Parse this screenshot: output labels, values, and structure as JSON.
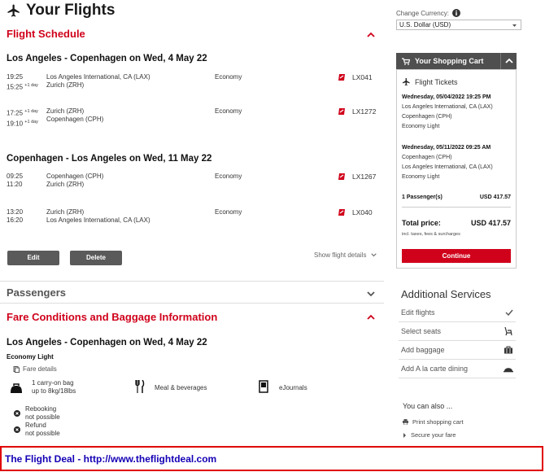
{
  "header": {
    "title": "Your Flights"
  },
  "schedule": {
    "title": "Flight Schedule",
    "outbound": {
      "title": "Los Angeles - Copenhagen on Wed, 4 May 22",
      "segments": [
        {
          "dep_time": "19:25",
          "arr_time": "15:25",
          "arr_day": "+1 day",
          "from": "Los Angeles International, CA (LAX)",
          "to": "Zurich (ZRH)",
          "class": "Economy",
          "flight": "LX041"
        },
        {
          "dep_time": "17:25",
          "dep_day": "+1 day",
          "arr_time": "19:10",
          "arr_day": "+1 day",
          "from": "Zurich (ZRH)",
          "to": "Copenhagen (CPH)",
          "class": "Economy",
          "flight": "LX1272"
        }
      ]
    },
    "inbound": {
      "title": "Copenhagen - Los Angeles on Wed, 11 May 22",
      "segments": [
        {
          "dep_time": "09:25",
          "arr_time": "11:20",
          "from": "Copenhagen (CPH)",
          "to": "Zurich (ZRH)",
          "class": "Economy",
          "flight": "LX1267"
        },
        {
          "dep_time": "13:20",
          "arr_time": "16:20",
          "from": "Zurich (ZRH)",
          "to": "Los Angeles International, CA (LAX)",
          "class": "Economy",
          "flight": "LX040"
        }
      ]
    },
    "edit_label": "Edit",
    "delete_label": "Delete",
    "details_label": "Show flight details"
  },
  "passengers": {
    "title": "Passengers"
  },
  "fare": {
    "title": "Fare Conditions and Baggage Information",
    "route_title": "Los Angeles - Copenhagen on Wed, 4 May 22",
    "class_name": "Economy Light",
    "details_label": "Fare details",
    "bag_line1": "1 carry-on bag",
    "bag_line2": "up to 8kg/18lbs",
    "meal": "Meal & beverages",
    "journals": "eJournals",
    "rebook_1": "Rebooking",
    "rebook_2": "not possible",
    "refund_1": "Refund",
    "refund_2": "not possible"
  },
  "currency": {
    "label": "Change Currency:",
    "value": "U.S. Dollar (USD)"
  },
  "cart": {
    "title": "Your Shopping Cart",
    "section": "Flight Tickets",
    "out_date": "Wednesday, 05/04/2022 19:25 PM",
    "out_from": "Los Angeles International, CA (LAX)",
    "out_to": "Copenhagen (CPH)",
    "out_class": "Economy Light",
    "in_date": "Wednesday, 05/11/2022 09:25 AM",
    "in_from": "Copenhagen (CPH)",
    "in_to": "Los Angeles International, CA (LAX)",
    "in_class": "Economy Light",
    "passengers": "1 Passenger(s)",
    "passengers_price": "USD 417.57",
    "total_label": "Total price:",
    "total_value": "USD 417.57",
    "taxes_note": "incl. taxes, fees & surcharges",
    "continue_label": "Continue"
  },
  "services": {
    "title": "Additional Services",
    "items": [
      "Edit flights",
      "Select seats",
      "Add baggage",
      "Add A la carte dining"
    ]
  },
  "also": {
    "title": "You can also ...",
    "print": "Print shopping cart",
    "secure": "Secure your fare"
  },
  "footer": {
    "text": "The Flight Deal - http://www.theflightdeal.com"
  },
  "colors": {
    "accent": "#d0021b",
    "footer_text": "#1400b5",
    "footer_border": "#e00000"
  }
}
